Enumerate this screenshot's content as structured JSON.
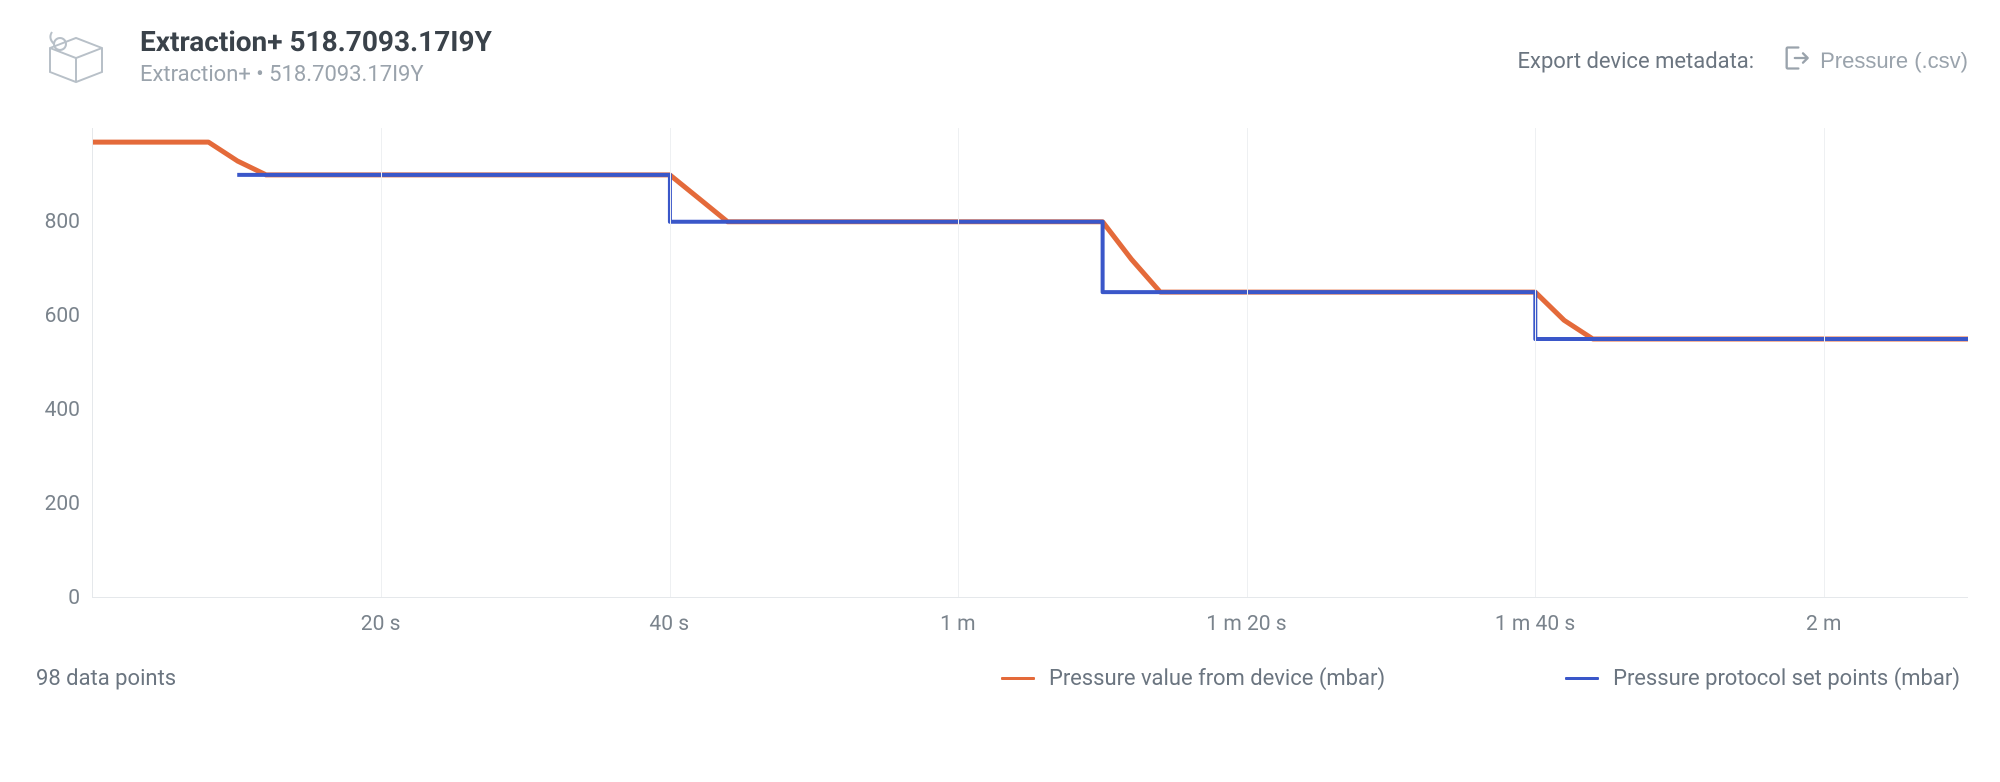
{
  "header": {
    "title": "Extraction+ 518.7093.17I9Y",
    "subtitle": "Extraction+ • 518.7093.17I9Y",
    "export_label": "Export device metadata:",
    "export_button": "Pressure (.csv)"
  },
  "chart_data": {
    "type": "line",
    "title": "",
    "xlabel": "",
    "ylabel": "",
    "ylim": [
      0,
      1000
    ],
    "x_ticks": [
      {
        "t": 20,
        "label": "20 s"
      },
      {
        "t": 40,
        "label": "40 s"
      },
      {
        "t": 60,
        "label": "1 m"
      },
      {
        "t": 80,
        "label": "1 m 20 s"
      },
      {
        "t": 100,
        "label": "1 m 40 s"
      },
      {
        "t": 120,
        "label": "2 m"
      }
    ],
    "y_ticks": [
      0,
      200,
      400,
      600,
      800
    ],
    "x_range": [
      0,
      130
    ],
    "series": [
      {
        "name": "Pressure value from device (mbar)",
        "color": "#e46a3a",
        "x": [
          0,
          8,
          10,
          12,
          40,
          42,
          44,
          70,
          72,
          74,
          100,
          102,
          104,
          130
        ],
        "y": [
          970,
          970,
          930,
          900,
          900,
          850,
          800,
          800,
          720,
          650,
          650,
          590,
          550,
          550
        ]
      },
      {
        "name": "Pressure protocol set points (mbar)",
        "color": "#3a57c9",
        "x": [
          10,
          40,
          40,
          70,
          70,
          100,
          100,
          130
        ],
        "y": [
          900,
          900,
          800,
          800,
          650,
          650,
          550,
          550
        ]
      }
    ],
    "data_points_label": "98 data points"
  },
  "colors": {
    "series1": "#e46a3a",
    "series2": "#3a57c9"
  }
}
